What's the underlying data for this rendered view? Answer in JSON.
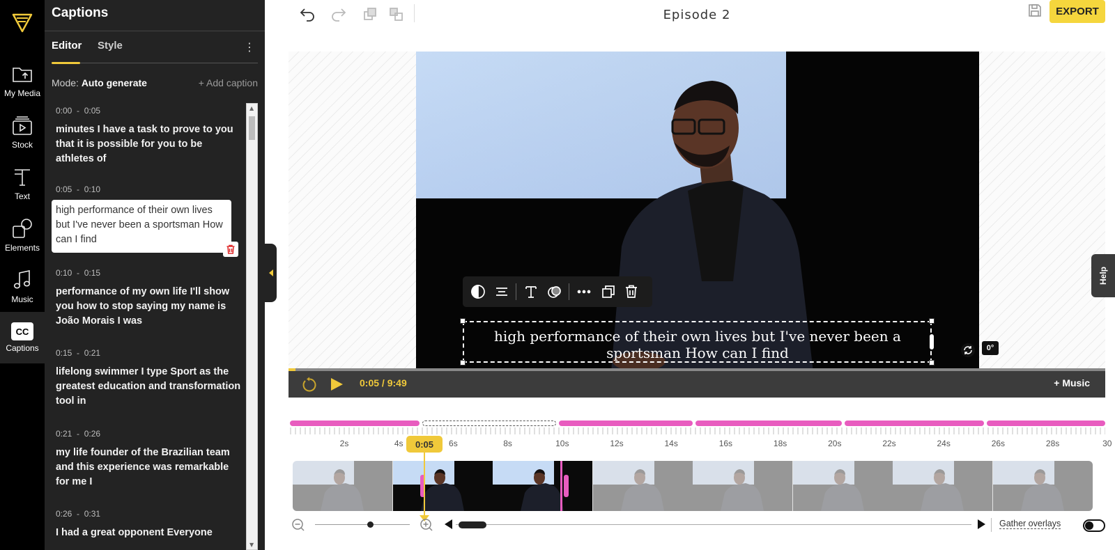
{
  "app": {
    "project_title": "Episode 2",
    "export_label": "EXPORT"
  },
  "rail": {
    "items": [
      {
        "label": "My Media",
        "icon": "folder-upload-icon"
      },
      {
        "label": "Stock",
        "icon": "stock-video-icon"
      },
      {
        "label": "Text",
        "icon": "text-icon"
      },
      {
        "label": "Elements",
        "icon": "shapes-icon"
      },
      {
        "label": "Music",
        "icon": "music-note-icon"
      },
      {
        "label": "Captions",
        "icon": "cc-icon",
        "badge": "CC",
        "active": true
      }
    ]
  },
  "panel": {
    "title": "Captions",
    "tabs": [
      "Editor",
      "Style"
    ],
    "active_tab": "Editor",
    "mode_label": "Mode:",
    "mode_value": "Auto generate",
    "add_caption": "+ Add caption",
    "captions": [
      {
        "start": "0:00",
        "end": "0:05",
        "text": "minutes I have a task to prove to you that it is possible for you to be athletes of"
      },
      {
        "start": "0:05",
        "end": "0:10",
        "text": "high performance of their own lives but I've never been a sportsman How can I find",
        "editing": true
      },
      {
        "start": "0:10",
        "end": "0:15",
        "text": "performance of my own life I'll show you how to stop saying my name is João Morais I was"
      },
      {
        "start": "0:15",
        "end": "0:21",
        "text": "lifelong swimmer I type Sport as the greatest education and transformation tool in"
      },
      {
        "start": "0:21",
        "end": "0:26",
        "text": "my life founder of the Brazilian team and this experience was remarkable for me I"
      },
      {
        "start": "0:26",
        "end": "0:31",
        "text": "I had a great opponent Everyone"
      }
    ],
    "time_separator": "-"
  },
  "stage": {
    "caption_text": "high performance of their own lives but I've never been a sportsman How can I find",
    "rotation": "0°"
  },
  "player": {
    "current": "0:05",
    "total": "9:49",
    "separator": "/",
    "progress_fraction": 0.0085,
    "music_label": "+ Music"
  },
  "timeline": {
    "playhead_label": "0:05",
    "ruler": [
      "2s",
      "4s",
      "6s",
      "8s",
      "10s",
      "12s",
      "14s",
      "16s",
      "18s",
      "20s",
      "22s",
      "24s",
      "26s",
      "28s",
      "30"
    ],
    "gather_label": "Gather overlays",
    "gather_on": false
  },
  "help_label": "Help",
  "colors": {
    "accent": "#f0c93a",
    "caption_segment": "#e85cbf",
    "panel_bg": "#232323",
    "rail_bg": "#000000"
  }
}
